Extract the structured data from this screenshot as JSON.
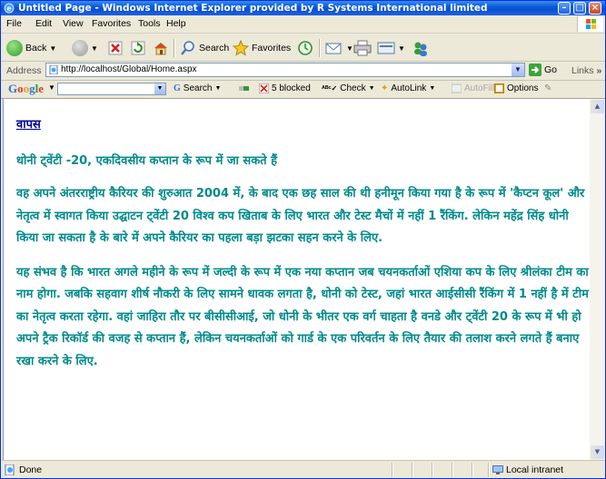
{
  "window": {
    "title": "Untitled Page - Windows Internet Explorer provided by R Systems International limited"
  },
  "menu": [
    "File",
    "Edit",
    "View",
    "Favorites",
    "Tools",
    "Help"
  ],
  "toolbar": {
    "back_label": "Back",
    "search_label": "Search",
    "favorites_label": "Favorites"
  },
  "address": {
    "label": "Address",
    "url": "http://localhost/Global/Home.aspx",
    "go_label": "Go",
    "links_label": "Links"
  },
  "google_toolbar": {
    "logo": "Google",
    "search_label": "Search",
    "blocked_label": "5 blocked",
    "check_label": "Check",
    "autolink_label": "AutoLink",
    "autofill_label": "AutoFill",
    "options_label": "Options"
  },
  "content": {
    "back_link": "वापस",
    "headline": "धोनी ट्वेंटी -20, एकदिवसीय कप्तान के रूप में जा सकते हैं",
    "paragraph1": "वह अपने अंतरराष्ट्रीय कैरियर की शुरुआत 2004 में, के बाद एक छह साल की थी हनीमून किया गया है के रूप में 'कैप्टन कूल' और नेतृत्व में स्वागत किया उद्घाटन ट्वेंटी 20 विश्व कप खिताब के लिए भारत और टेस्ट मैचों में नहीं 1 रैंकिंग. लेकिन महेंद्र सिंह धोनी किया जा सकता है के बारे में अपने कैरियर का पहला बड़ा झटका सहन करने के लिए.",
    "paragraph2": "यह संभव है कि भारत अगले महीने के रूप में जल्दी के रूप में एक नया कप्तान जब चयनकर्ताओं एशिया कप के लिए श्रीलंका टीम का नाम होगा. जबकि सहवाग शीर्ष नौकरी के लिए सामने धावक लगता है, धोनी को टेस्ट, जहां भारत आईसीसी रैंकिंग में 1 नहीं है में टीम का नेतृत्व करता रहेगा. वहां जाहिरा तौर पर बीसीसीआई, जो धोनी के भीतर एक वर्ग चाहता है वनडे और ट्वेंटी 20 के रूप में भी हो अपने ट्रैक रिकॉर्ड की वजह से कप्तान हैं, लेकिन चयनकर्ताओं को गार्ड के एक परिवर्तन के लिए तैयार की तलाश करने लगते हैं बनाए रखा करने के लिए."
  },
  "status": {
    "text": "Done",
    "zone": "Local intranet"
  },
  "colors": {
    "content_text": "#008a8a",
    "link": "#000099",
    "titlebar": "#0a5bd6"
  }
}
